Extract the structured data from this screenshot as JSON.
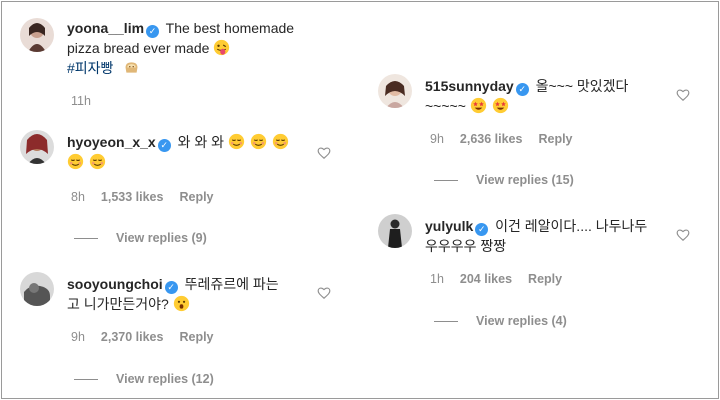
{
  "left_comments": [
    {
      "username": "yoona__lim",
      "text": "The best homemade pizza bread ever made",
      "hashtag": "#피자빵",
      "time": "11h"
    },
    {
      "username": "hyoyeon_x_x",
      "text": "와 와 와",
      "time": "8h",
      "likes": "1,533 likes",
      "reply": "Reply",
      "view_replies": "View replies (9)"
    },
    {
      "username": "sooyoungchoi",
      "text_line1": "뚜레쥬르에 파는",
      "text_line2": "고 니가만든거야?",
      "time": "9h",
      "likes": "2,370 likes",
      "reply": "Reply",
      "view_replies": "View replies (12)"
    }
  ],
  "right_comments": [
    {
      "username": "515sunnyday",
      "text_line1": "올~~~ 맛있겠다",
      "text_line2": "~~~~~",
      "time": "9h",
      "likes": "2,636 likes",
      "reply": "Reply",
      "view_replies": "View replies (15)"
    },
    {
      "username": "yulyulk",
      "text_line1": "이건 레알이다.... 나두나두",
      "text_line2": "우우우우 짱짱",
      "time": "1h",
      "likes": "204 likes",
      "reply": "Reply",
      "view_replies": "View replies (4)"
    }
  ],
  "icons": {
    "verified": "✓"
  },
  "colors": {
    "verified": "#3897f0",
    "meta": "#8e8e8e",
    "hashtag": "#00376b"
  }
}
